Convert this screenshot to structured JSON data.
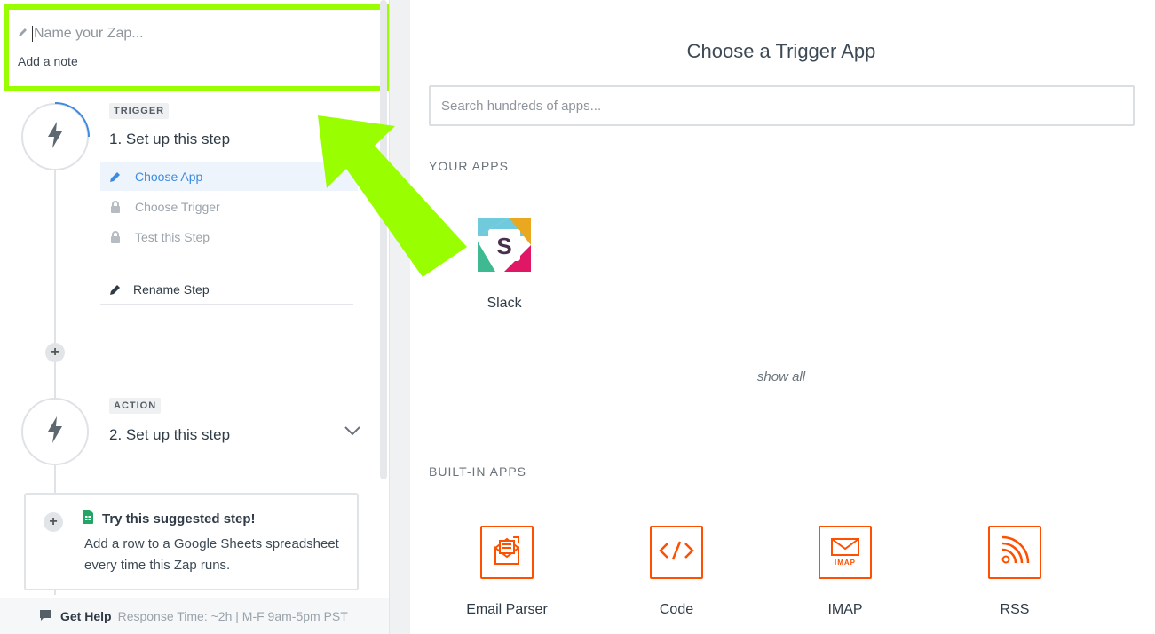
{
  "zap": {
    "name_placeholder": "Name your Zap...",
    "add_note": "Add a note"
  },
  "trigger_step": {
    "tag": "TRIGGER",
    "title": "1. Set up this step",
    "items": [
      {
        "label": "Choose App",
        "state": "active"
      },
      {
        "label": "Choose Trigger",
        "state": "locked"
      },
      {
        "label": "Test this Step",
        "state": "locked"
      }
    ],
    "rename": "Rename Step"
  },
  "action_step": {
    "tag": "ACTION",
    "title": "2. Set up this step"
  },
  "suggestion": {
    "title": "Try this suggested step!",
    "text": "Add a row to a Google Sheets spreadsheet every time this Zap runs."
  },
  "help": {
    "label": "Get Help",
    "meta": "Response Time: ~2h | M-F 9am-5pm PST"
  },
  "main": {
    "title": "Choose a Trigger App",
    "search_placeholder": "Search hundreds of apps...",
    "your_apps_label": "YOUR APPS",
    "your_apps": [
      {
        "name": "Slack",
        "icon": "slack-logo"
      }
    ],
    "show_all": "show all",
    "builtin_label": "BUILT-IN APPS",
    "builtin_apps": [
      {
        "name": "Email Parser",
        "icon": "email-parser-icon"
      },
      {
        "name": "Code",
        "icon": "code-icon"
      },
      {
        "name": "IMAP",
        "icon": "imap-icon",
        "badge": "IMAP"
      },
      {
        "name": "RSS",
        "icon": "rss-icon"
      }
    ]
  },
  "colors": {
    "highlight": "#99ff00",
    "accent_blue": "#3c8be0",
    "builtin_orange": "#ff4f00"
  }
}
